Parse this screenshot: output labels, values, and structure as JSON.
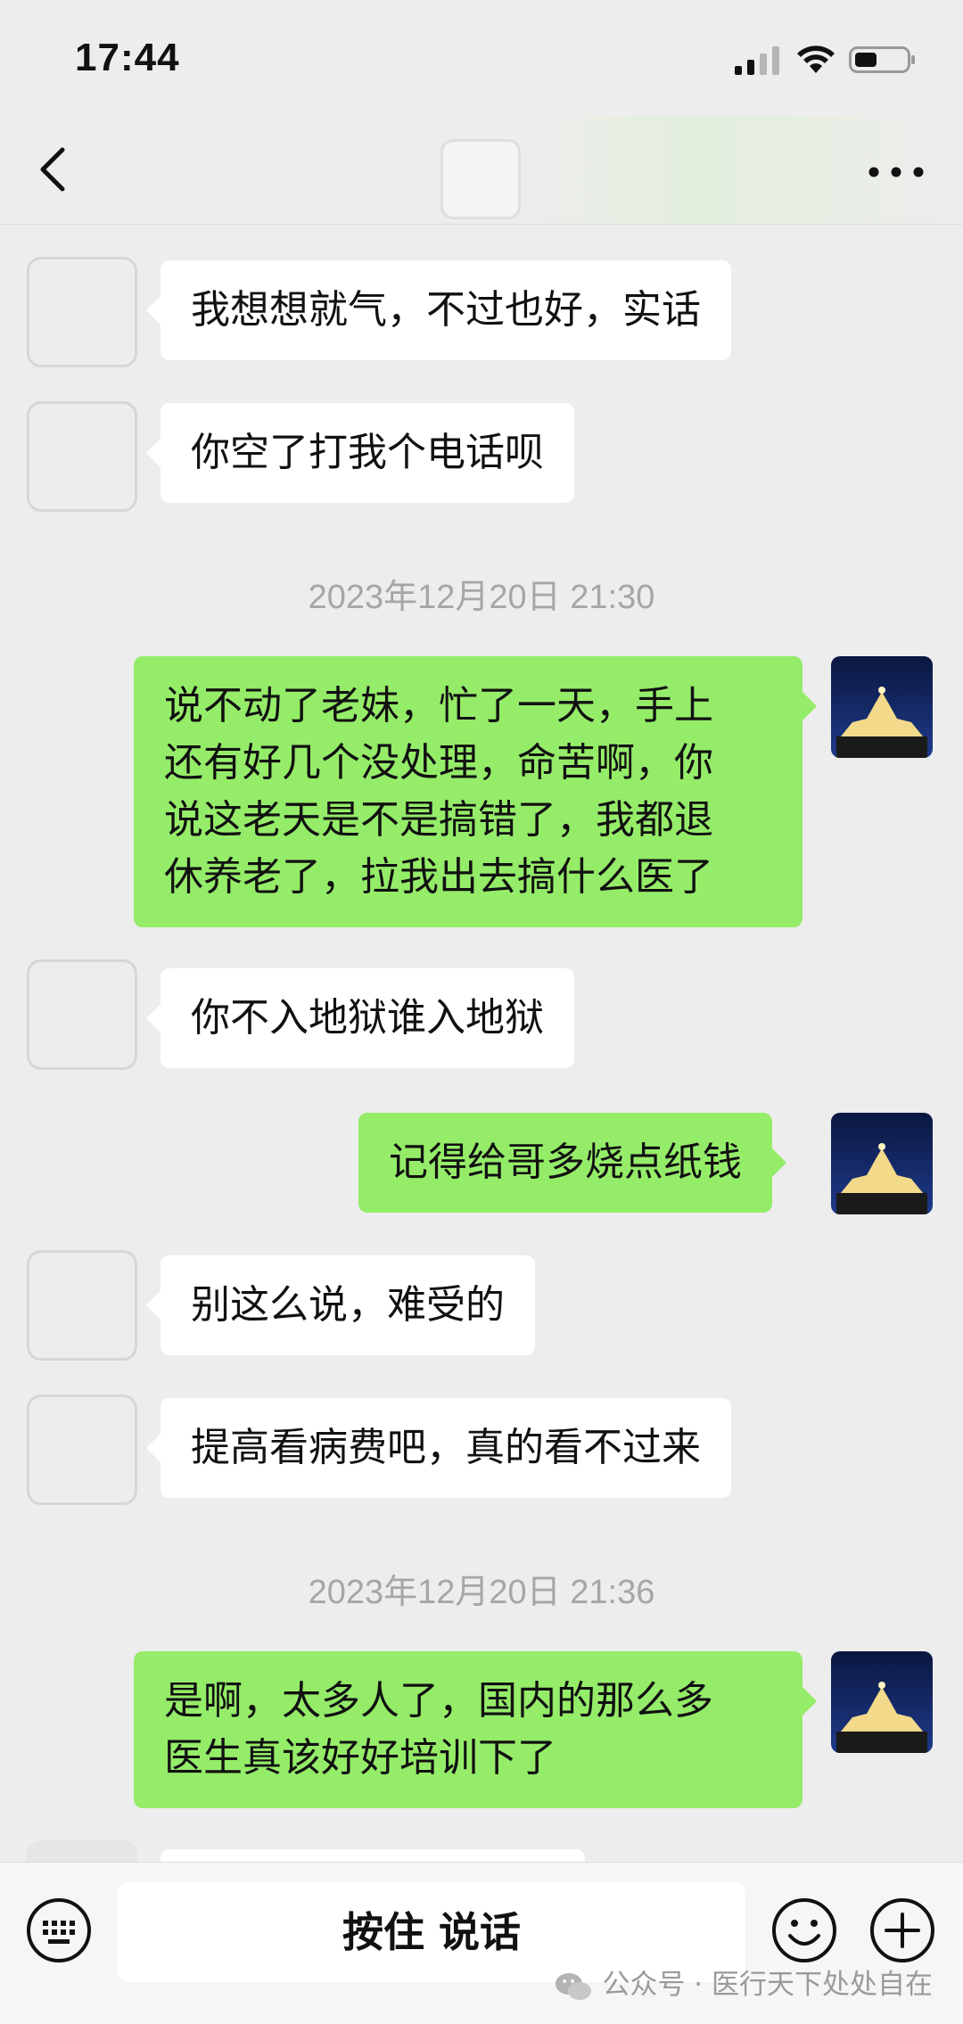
{
  "status_bar": {
    "time": "17:44"
  },
  "nav": {
    "icons": [
      "back-chevron-icon",
      "more-dots-icon"
    ]
  },
  "timestamps": [
    "2023年12月20日 21:30",
    "2023年12月20日 21:36"
  ],
  "messages": [
    {
      "side": "left",
      "text": "我想想就气，不过也好，实话"
    },
    {
      "side": "left",
      "text": "你空了打我个电话呗"
    },
    {
      "side": "right",
      "lines": [
        "说不动了老妹，忙了一天，手上",
        "还有好几个没处理，命苦啊，你",
        "说这老天是不是搞错了，我都退",
        "休养老了，拉我出去搞什么医了"
      ]
    },
    {
      "side": "left",
      "text": "你不入地狱谁入地狱"
    },
    {
      "side": "right",
      "text": "记得给哥多烧点纸钱"
    },
    {
      "side": "left",
      "text": "别这么说，难受的"
    },
    {
      "side": "left",
      "text": "提高看病费吧，真的看不过来"
    },
    {
      "side": "right",
      "lines": [
        "是啊，太多人了，国内的那么多",
        "医生真该好好培训下了"
      ]
    }
  ],
  "input_bar": {
    "hold_to_talk_label": "按住 说话",
    "icons": [
      "keyboard-icon",
      "emoji-icon",
      "plus-icon"
    ]
  },
  "watermark": {
    "text": "公众号 · 医行天下处处自在"
  },
  "colors": {
    "background": "#ededed",
    "my_bubble": "#95ec69",
    "their_bubble": "#ffffff",
    "timestamp": "#a6a6a6"
  }
}
